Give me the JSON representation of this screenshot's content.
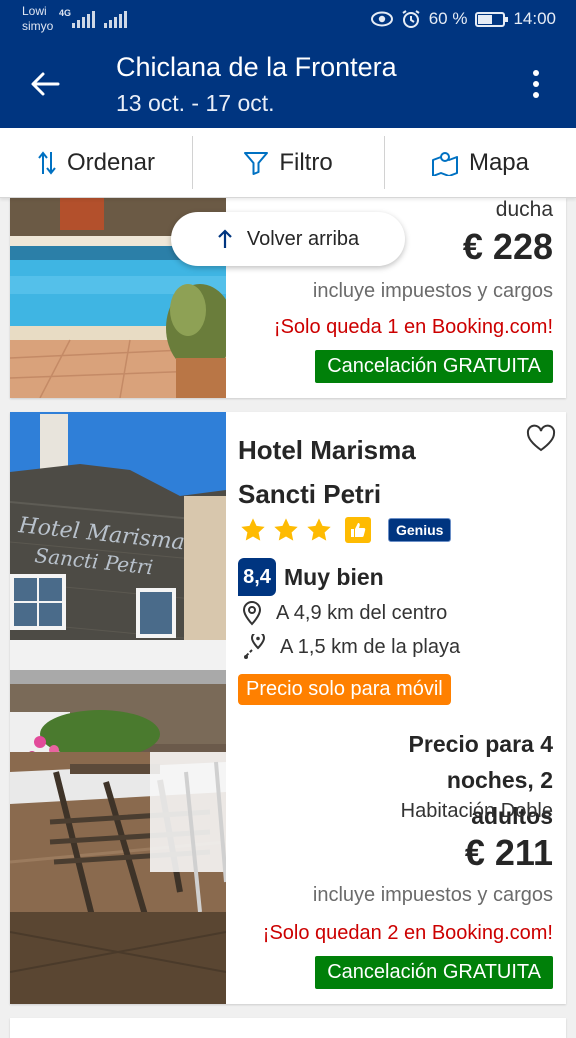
{
  "status_bar": {
    "carrier1": "Lowi",
    "carrier2": "simyo",
    "network": "4G",
    "battery_percent": "60 %",
    "battery_level": 0.6,
    "time": "14:00"
  },
  "app_bar": {
    "title": "Chiclana de la Frontera",
    "dates": "13 oct. - 17 oct."
  },
  "toolbar": {
    "sort_label": "Ordenar",
    "filter_label": "Filtro",
    "map_label": "Mapa"
  },
  "back_to_top": "Volver arriba",
  "listings": [
    {
      "room_tail": "ducha",
      "price": "€ 228",
      "taxes": "incluye impuestos y cargos",
      "scarcity": "¡Solo queda 1 en Booking.com!",
      "cancellation": "Cancelación GRATUITA"
    },
    {
      "name": "Hotel Marisma Sancti Petri",
      "stars": 3,
      "genius": "Genius",
      "score": "8,4",
      "score_word": "Muy bien",
      "distance_center": "A 4,9 km del centro",
      "distance_beach": "A 1,5 km de la playa",
      "mobile_badge": "Precio solo para móvil",
      "price_for": "Precio para 4 noches, 2 adultos",
      "room": "Habitación Doble",
      "price": "€ 211",
      "taxes": "incluye impuestos y cargos",
      "scarcity": "¡Solo quedan 2 en Booking.com!",
      "cancellation": "Cancelación GRATUITA"
    }
  ],
  "colors": {
    "brand_blue": "#003580",
    "green": "#008009",
    "scarcity_red": "#cc0000",
    "orange": "#ff8000",
    "star_yellow": "#febb02"
  }
}
